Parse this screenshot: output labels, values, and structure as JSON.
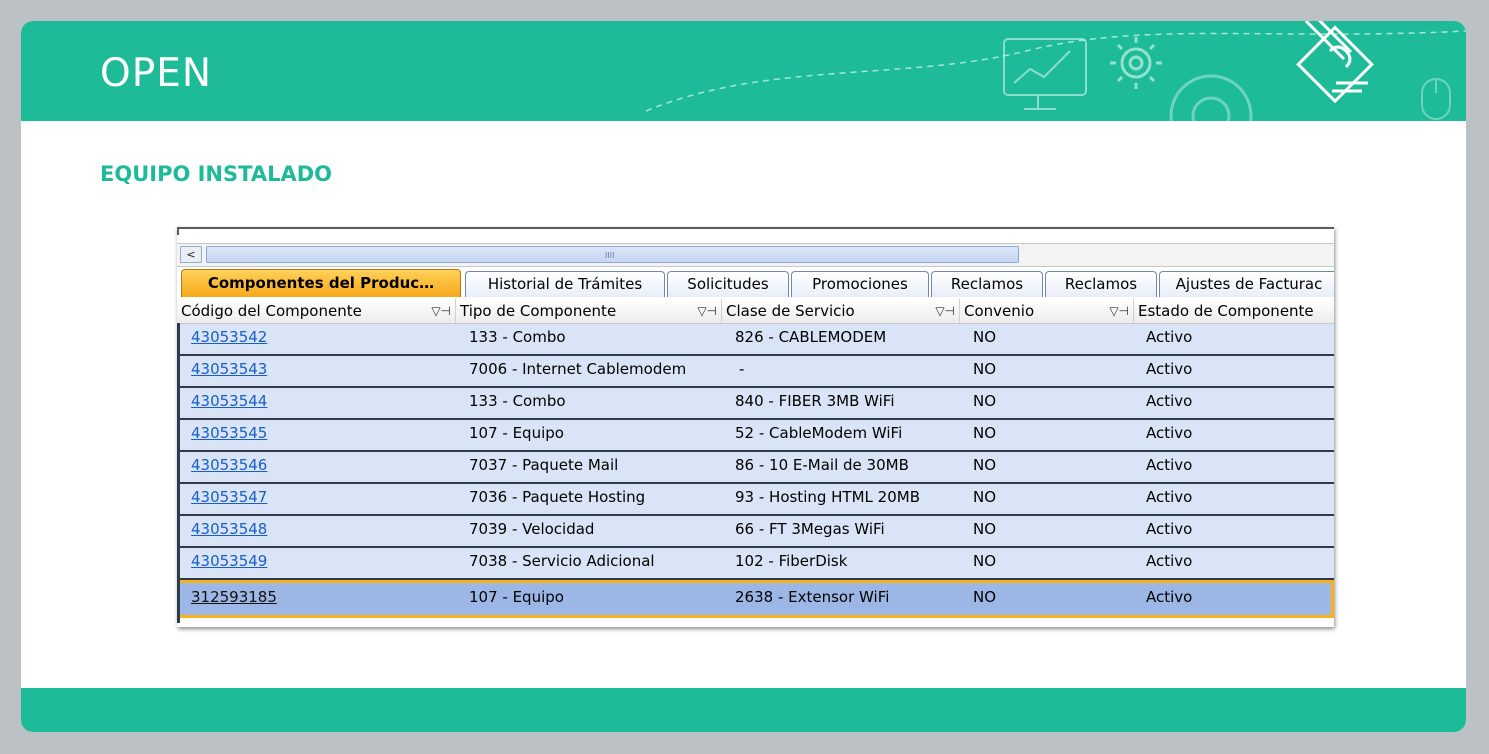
{
  "slide": {
    "title": "OPEN",
    "section_title": "EQUIPO INSTALADO"
  },
  "colors": {
    "brand": "#1dbb98",
    "selected_row_border": "#f5b21b",
    "active_tab": "#f7a71a",
    "row_bg": "#d9e5f6",
    "selected_row_bg": "#9cb7e6",
    "link": "#1a5dc8"
  },
  "screenshot": {
    "tabs": [
      {
        "label": "Componentes del Produc…",
        "active": true
      },
      {
        "label": "Historial de Trámites",
        "active": false
      },
      {
        "label": "Solicitudes",
        "active": false
      },
      {
        "label": "Promociones",
        "active": false
      },
      {
        "label": "Reclamos",
        "active": false
      },
      {
        "label": "Reclamos",
        "active": false
      },
      {
        "label": "Ajustes de Facturac",
        "active": false
      }
    ],
    "columns": [
      {
        "label": "Código del Componente",
        "filter_icon": "filter-pin-icon"
      },
      {
        "label": "Tipo de Componente",
        "filter_icon": "filter-pin-icon"
      },
      {
        "label": "Clase de Servicio",
        "filter_icon": "filter-pin-icon"
      },
      {
        "label": "Convenio",
        "filter_icon": "filter-pin-icon"
      },
      {
        "label": "Estado de Componente",
        "filter_icon": null
      }
    ],
    "rows": [
      {
        "codigo": "43053542",
        "tipo": "133 - Combo",
        "clase": "826 - CABLEMODEM",
        "convenio": "NO",
        "estado": "Activo"
      },
      {
        "codigo": "43053543",
        "tipo": "7006 - Internet Cablemodem",
        "clase": "-",
        "convenio": "NO",
        "estado": "Activo"
      },
      {
        "codigo": "43053544",
        "tipo": "133 - Combo",
        "clase": "840 - FIBER 3MB WiFi",
        "convenio": "NO",
        "estado": "Activo"
      },
      {
        "codigo": "43053545",
        "tipo": "107 - Equipo",
        "clase": "52 - CableModem WiFi",
        "convenio": "NO",
        "estado": "Activo"
      },
      {
        "codigo": "43053546",
        "tipo": "7037 - Paquete Mail",
        "clase": "86 - 10 E-Mail de 30MB",
        "convenio": "NO",
        "estado": "Activo"
      },
      {
        "codigo": "43053547",
        "tipo": "7036 - Paquete Hosting",
        "clase": "93 - Hosting HTML 20MB",
        "convenio": "NO",
        "estado": "Activo"
      },
      {
        "codigo": "43053548",
        "tipo": "7039 - Velocidad",
        "clase": "66 - FT 3Megas WiFi",
        "convenio": "NO",
        "estado": "Activo"
      },
      {
        "codigo": "43053549",
        "tipo": "7038 - Servicio Adicional",
        "clase": "102 - FiberDisk",
        "convenio": "NO",
        "estado": "Activo"
      },
      {
        "codigo": "312593185",
        "tipo": "107 - Equipo",
        "clase": "2638 - Extensor WiFi",
        "convenio": "NO",
        "estado": "Activo",
        "selected": true
      }
    ],
    "scroll_left_icon": "chevron-left-icon",
    "scroll_grip": "IIII"
  },
  "decor_icons": [
    "monitor-chart-icon",
    "gear-icon",
    "large-gear-icon",
    "document-pencil-icon",
    "mouse-icon"
  ]
}
